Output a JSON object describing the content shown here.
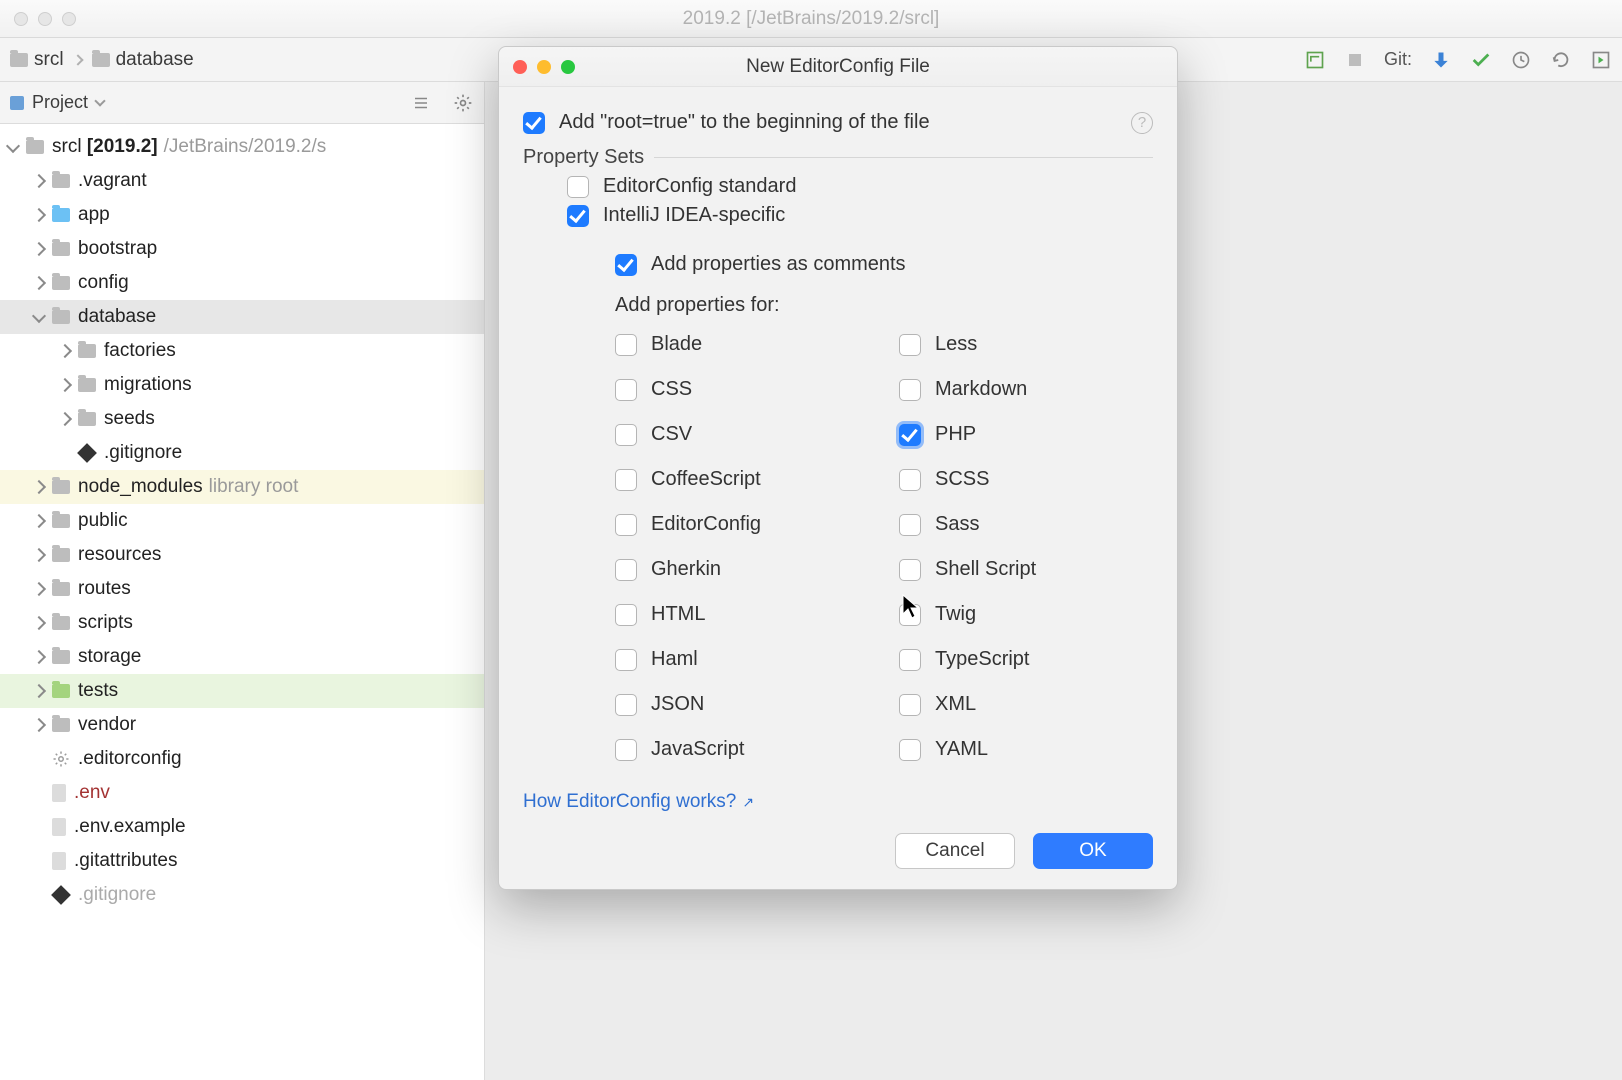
{
  "window": {
    "title": "2019.2 [/JetBrains/2019.2/srcl]"
  },
  "breadcrumb": {
    "items": [
      "srcl",
      "database"
    ]
  },
  "toolbar": {
    "git_label": "Git:"
  },
  "project_panel": {
    "title": "Project",
    "root": {
      "name": "srcl",
      "bold": "2019.2",
      "path": "/JetBrains/2019.2/s"
    },
    "tree": [
      {
        "depth": 1,
        "arrow": "right",
        "icon": "folder",
        "label": ".vagrant"
      },
      {
        "depth": 1,
        "arrow": "right",
        "icon": "folder-blue",
        "label": "app"
      },
      {
        "depth": 1,
        "arrow": "right",
        "icon": "folder",
        "label": "bootstrap"
      },
      {
        "depth": 1,
        "arrow": "right",
        "icon": "folder",
        "label": "config"
      },
      {
        "depth": 1,
        "arrow": "open",
        "icon": "folder",
        "label": "database",
        "sel": true
      },
      {
        "depth": 2,
        "arrow": "right",
        "icon": "folder",
        "label": "factories"
      },
      {
        "depth": 2,
        "arrow": "right",
        "icon": "folder",
        "label": "migrations"
      },
      {
        "depth": 2,
        "arrow": "right",
        "icon": "folder",
        "label": "seeds"
      },
      {
        "depth": 2,
        "arrow": "none",
        "icon": "diamond",
        "label": ".gitignore"
      },
      {
        "depth": 1,
        "arrow": "right",
        "icon": "folder",
        "label": "node_modules",
        "aux": "library root",
        "hl": "yellow"
      },
      {
        "depth": 1,
        "arrow": "right",
        "icon": "folder",
        "label": "public"
      },
      {
        "depth": 1,
        "arrow": "right",
        "icon": "folder",
        "label": "resources"
      },
      {
        "depth": 1,
        "arrow": "right",
        "icon": "folder",
        "label": "routes"
      },
      {
        "depth": 1,
        "arrow": "right",
        "icon": "folder",
        "label": "scripts"
      },
      {
        "depth": 1,
        "arrow": "right",
        "icon": "folder",
        "label": "storage"
      },
      {
        "depth": 1,
        "arrow": "right",
        "icon": "folder-green",
        "label": "tests",
        "hl": "green"
      },
      {
        "depth": 1,
        "arrow": "right",
        "icon": "folder",
        "label": "vendor"
      },
      {
        "depth": 1,
        "arrow": "none",
        "icon": "gear",
        "label": ".editorconfig"
      },
      {
        "depth": 1,
        "arrow": "none",
        "icon": "file",
        "label": ".env",
        "color": "red"
      },
      {
        "depth": 1,
        "arrow": "none",
        "icon": "file",
        "label": ".env.example"
      },
      {
        "depth": 1,
        "arrow": "none",
        "icon": "file",
        "label": ".gitattributes"
      },
      {
        "depth": 1,
        "arrow": "none",
        "icon": "diamond",
        "label": ".gitignore",
        "color": "muted"
      }
    ]
  },
  "modal": {
    "title": "New EditorConfig File",
    "add_root": {
      "label": "Add \"root=true\" to the beginning of the file",
      "checked": true
    },
    "section": "Property Sets",
    "sets": {
      "standard": {
        "label": "EditorConfig standard",
        "checked": false
      },
      "intellij": {
        "label": "IntelliJ IDEA-specific",
        "checked": true
      },
      "as_comments": {
        "label": "Add properties as comments",
        "checked": true
      }
    },
    "prop_for_label": "Add properties for:",
    "langs_col1": [
      {
        "label": "Blade",
        "checked": false
      },
      {
        "label": "CSS",
        "checked": false
      },
      {
        "label": "CSV",
        "checked": false
      },
      {
        "label": "CoffeeScript",
        "checked": false
      },
      {
        "label": "EditorConfig",
        "checked": false
      },
      {
        "label": "Gherkin",
        "checked": false
      },
      {
        "label": "HTML",
        "checked": false
      },
      {
        "label": "Haml",
        "checked": false
      },
      {
        "label": "JSON",
        "checked": false
      },
      {
        "label": "JavaScript",
        "checked": false
      }
    ],
    "langs_col2": [
      {
        "label": "Less",
        "checked": false
      },
      {
        "label": "Markdown",
        "checked": false
      },
      {
        "label": "PHP",
        "checked": true,
        "focus": true
      },
      {
        "label": "SCSS",
        "checked": false
      },
      {
        "label": "Sass",
        "checked": false
      },
      {
        "label": "Shell Script",
        "checked": false
      },
      {
        "label": "Twig",
        "checked": false
      },
      {
        "label": "TypeScript",
        "checked": false
      },
      {
        "label": "XML",
        "checked": false
      },
      {
        "label": "YAML",
        "checked": false
      }
    ],
    "help_link": "How EditorConfig works?",
    "buttons": {
      "cancel": "Cancel",
      "ok": "OK"
    }
  }
}
